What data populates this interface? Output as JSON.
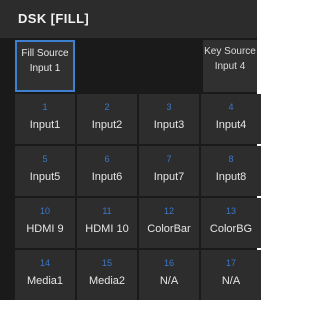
{
  "header": {
    "title": "DSK [FILL]"
  },
  "fill_source": {
    "label": "Fill Source",
    "value": "Input 1"
  },
  "key_source": {
    "label": "Key Source",
    "value": "Input 4"
  },
  "buttons": [
    {
      "num": "1",
      "label": "Input1"
    },
    {
      "num": "2",
      "label": "Input2"
    },
    {
      "num": "3",
      "label": "Input3"
    },
    {
      "num": "4",
      "label": "Input4"
    },
    {
      "num": "5",
      "label": "Input5"
    },
    {
      "num": "6",
      "label": "Input6"
    },
    {
      "num": "7",
      "label": "Input7"
    },
    {
      "num": "8",
      "label": "Input8"
    },
    {
      "num": "10",
      "label": "HDMI 9"
    },
    {
      "num": "11",
      "label": "HDMI 10"
    },
    {
      "num": "12",
      "label": "ColorBar"
    },
    {
      "num": "13",
      "label": "ColorBG"
    },
    {
      "num": "14",
      "label": "Media1"
    },
    {
      "num": "15",
      "label": "Media2"
    },
    {
      "num": "16",
      "label": "N/A"
    },
    {
      "num": "17",
      "label": "N/A"
    }
  ],
  "colors": {
    "accent": "#3e7fcf",
    "number_text": "#3a78c8",
    "panel_bg": "#1a1a1a",
    "button_bg": "#2d2d2d",
    "header_bg": "#2c2c2c"
  }
}
